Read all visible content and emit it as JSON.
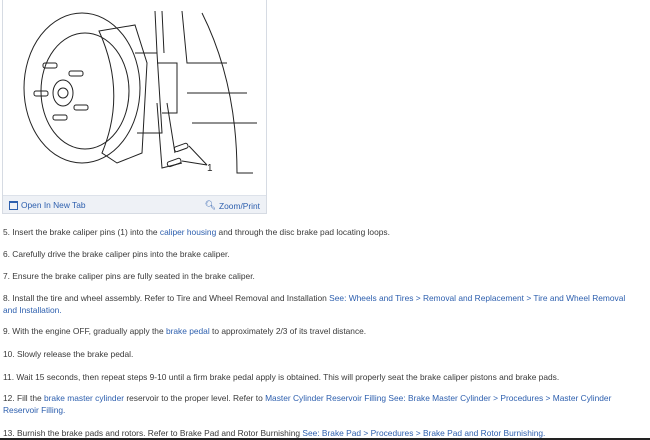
{
  "figure": {
    "callout_label": "1",
    "open_new_tab_label": "Open In New Tab",
    "zoom_print_label": "Zoom/Print",
    "colors": {
      "link": "#2d5fae",
      "bar": "#eef1f6"
    }
  },
  "steps": [
    [
      {
        "t": "5. Insert the brake caliper pins (1) into the "
      },
      {
        "t": "caliper housing",
        "link": true
      },
      {
        "t": " and through the disc brake pad locating loops."
      }
    ],
    [
      {
        "t": "6. Carefully drive the brake caliper pins into the brake caliper."
      }
    ],
    [
      {
        "t": "7. Ensure the brake caliper pins are fully seated in the brake caliper."
      }
    ],
    [
      {
        "t": "8. Install the tire and wheel assembly. Refer to Tire and Wheel Removal and Installation "
      },
      {
        "t": "See: Wheels and Tires > Removal and Replacement > Tire and Wheel Removal and Installation.",
        "link": true
      }
    ],
    [
      {
        "t": "9. With the engine OFF, gradually apply the "
      },
      {
        "t": "brake pedal",
        "link": true
      },
      {
        "t": " to approximately 2/3 of its travel distance."
      }
    ],
    [
      {
        "t": "10. Slowly release the brake pedal."
      }
    ],
    [
      {
        "t": "11. Wait 15 seconds, then repeat steps 9-10 until a firm brake pedal apply is obtained. This will properly seat the brake caliper pistons and brake pads."
      }
    ],
    [
      {
        "t": "12. Fill the "
      },
      {
        "t": "brake master cylinder",
        "link": true
      },
      {
        "t": " reservoir to the proper level. Refer to "
      },
      {
        "t": "Master Cylinder Reservoir Filling",
        "link": true
      },
      {
        "t": " "
      },
      {
        "t": "See: Brake Master Cylinder > Procedures > Master Cylinder Reservoir Filling.",
        "link": true
      }
    ],
    [
      {
        "t": "13. Burnish the brake pads and rotors. Refer to Brake Pad and Rotor Burnishing "
      },
      {
        "t": "See: Brake Pad > Procedures > Brake Pad and Rotor Burnishing.",
        "link": true
      }
    ]
  ]
}
